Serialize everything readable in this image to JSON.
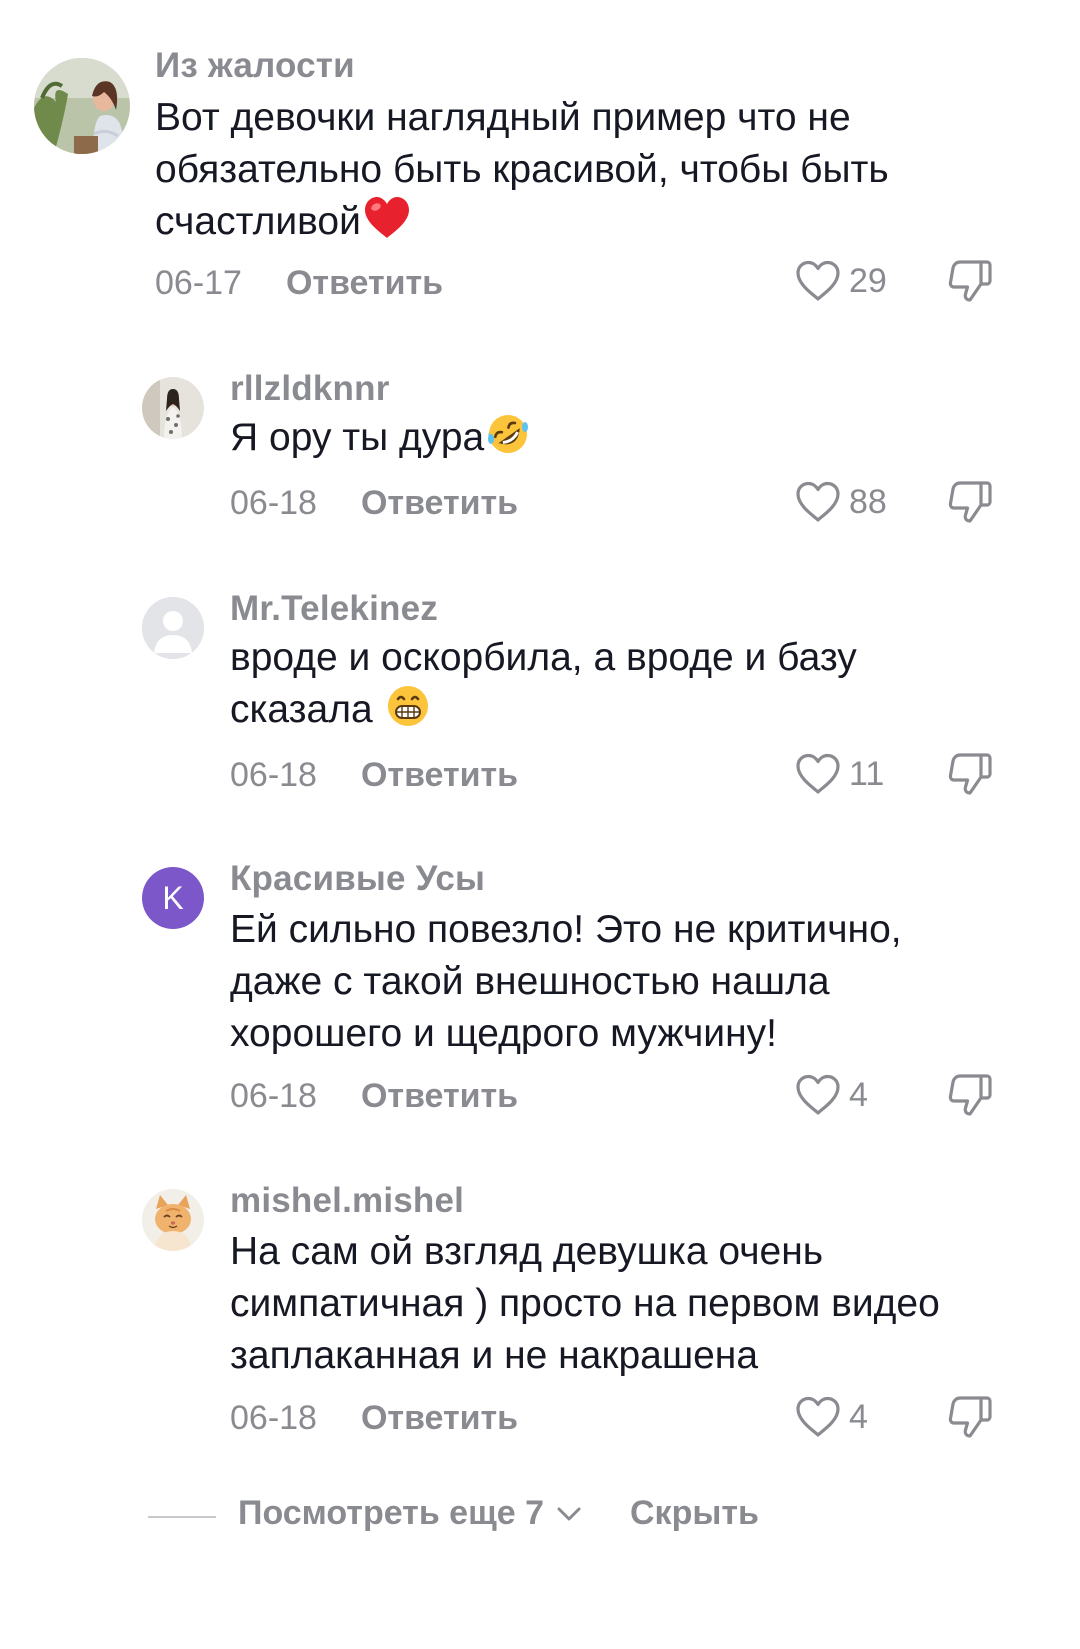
{
  "comments": [
    {
      "username": "Из жалости",
      "lines": [
        "Вот девочки наглядный пример что не",
        "обязательно быть красивой, чтобы быть",
        "счастливой"
      ],
      "emoji": "red-heart",
      "date": "06-17",
      "reply_label": "Ответить",
      "likes": "29"
    },
    {
      "username": "rllzldknnr",
      "lines": [
        "Я ору ты дура"
      ],
      "emoji": "rolling-on-floor-laughing",
      "date": "06-18",
      "reply_label": "Ответить",
      "likes": "88"
    },
    {
      "username": "Mr.Telekinez",
      "lines": [
        "вроде и оскорбила, а вроде и базу",
        "сказала "
      ],
      "emoji": "grinning-face",
      "date": "06-18",
      "reply_label": "Ответить",
      "likes": "11"
    },
    {
      "username": "Красивые Усы",
      "avatar_letter": "K",
      "avatar_color": "#7c57c9",
      "lines": [
        "Ей сильно повезло! Это не критично,",
        "даже с такой внешностью нашла",
        "хорошего и щедрого мужчину!"
      ],
      "date": "06-18",
      "reply_label": "Ответить",
      "likes": "4"
    },
    {
      "username": "mishel.mishel",
      "lines": [
        "На сам ой взгляд девушка очень",
        "симпатичная ) просто на первом видео",
        "заплаканная и не накрашена"
      ],
      "date": "06-18",
      "reply_label": "Ответить",
      "likes": "4"
    }
  ],
  "footer": {
    "view_more_label": "Посмотреть еще 7",
    "hide_label": "Скрыть"
  },
  "colors": {
    "text": "#161823",
    "muted": "#8a8b91",
    "heart_emoji": "#e8212e"
  },
  "icons": {
    "like": "heart-outline-icon",
    "dislike": "thumbs-down-icon",
    "expand": "chevron-down-icon"
  }
}
